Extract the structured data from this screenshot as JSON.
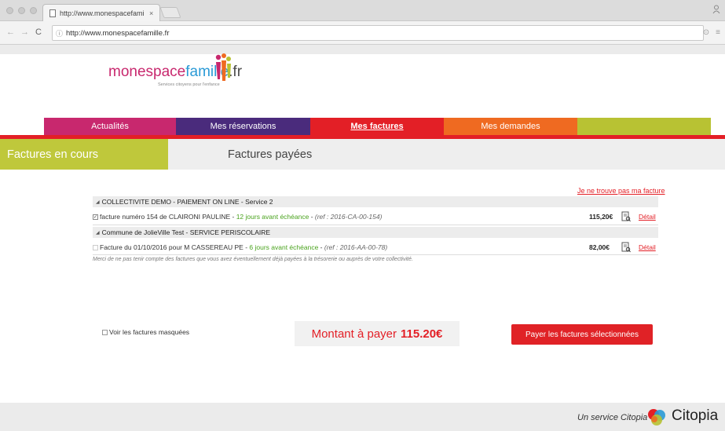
{
  "browser": {
    "tab_title": "http://www.monespacefamille.",
    "tab_close": "×",
    "url": "http://www.monespacefamille.fr",
    "back_icon": "←",
    "forward_icon": "→",
    "reload_icon": "C"
  },
  "logo": {
    "part1": "monespace",
    "part2": "famille",
    "part3": ".fr",
    "tagline": "Services citoyens pour l'enfance"
  },
  "nav": {
    "items": [
      {
        "label": "Actualités",
        "color": "#c8286e"
      },
      {
        "label": "Mes réservations",
        "color": "#4a2b7c"
      },
      {
        "label": "Mes factures",
        "color": "#e31f26"
      },
      {
        "label": "Mes demandes",
        "color": "#ef6a21"
      },
      {
        "label": "",
        "color": "#b8c233"
      }
    ]
  },
  "subtabs": {
    "active": "Factures en cours",
    "other": "Factures payées"
  },
  "invoices": {
    "not_found_link": "Je ne trouve pas ma facture",
    "groups": [
      {
        "header": "COLLECTIVITE DEMO - PAIEMENT ON LINE - Service 2",
        "row": {
          "checked": true,
          "text": "facture numéro 154 de CLAIRONI PAULINE - ",
          "due": "12 jours avant échéance",
          "sep": " - ",
          "ref": "(ref : 2016-CA-00-154)",
          "amount": "115,20€",
          "detail": "Détail"
        }
      },
      {
        "header": "Commune de JolieVille Test - SERVICE PERISCOLAIRE",
        "row": {
          "checked": false,
          "text": "Facture du 01/10/2016 pour M CASSEREAU PE - ",
          "due": "6 jours avant échéance",
          "sep": " - ",
          "ref": "(ref : 2016-AA-00-78)",
          "amount": "82,00€",
          "detail": "Détail"
        }
      }
    ],
    "notice": "Merci de ne pas tenir compte des factures que vous avez éventuellement déjà payées à la trésorerie ou auprès de votre collectivité."
  },
  "actions": {
    "show_hidden": "Voir les factures masquées",
    "amount_label": "Montant à payer",
    "amount_value": "115.20€",
    "pay_button": "Payer les factures sélectionnées"
  },
  "footer": {
    "text": "Un service Citopia",
    "brand": "Citopia"
  }
}
